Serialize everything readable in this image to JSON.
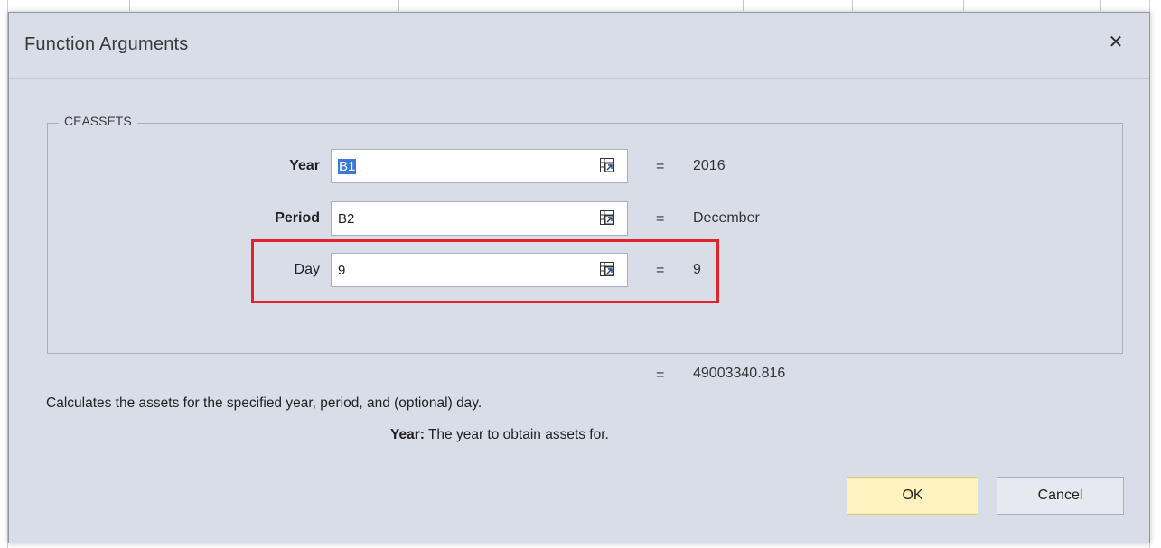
{
  "dialog": {
    "title": "Function Arguments",
    "close_icon": "close-icon"
  },
  "function": {
    "name": "CEASSETS",
    "arguments": [
      {
        "label": "Year",
        "bold": true,
        "value": "B1",
        "selected": true,
        "result": "2016"
      },
      {
        "label": "Period",
        "bold": true,
        "value": "B2",
        "selected": false,
        "result": "December"
      },
      {
        "label": "Day",
        "bold": false,
        "value": "9",
        "selected": false,
        "result": "9"
      }
    ],
    "formula_result": "49003340.816",
    "description": "Calculates the assets for the specified year, period, and (optional) day.",
    "help_name": "Year:",
    "help_text": "The year to obtain assets for."
  },
  "buttons": {
    "ok": "OK",
    "cancel": "Cancel"
  },
  "colors": {
    "dialog_bg": "#d8dde8",
    "highlight": "#e0242a",
    "ok_button": "#fdf2c0",
    "selection": "#3b78d8"
  },
  "equals_sign": "="
}
